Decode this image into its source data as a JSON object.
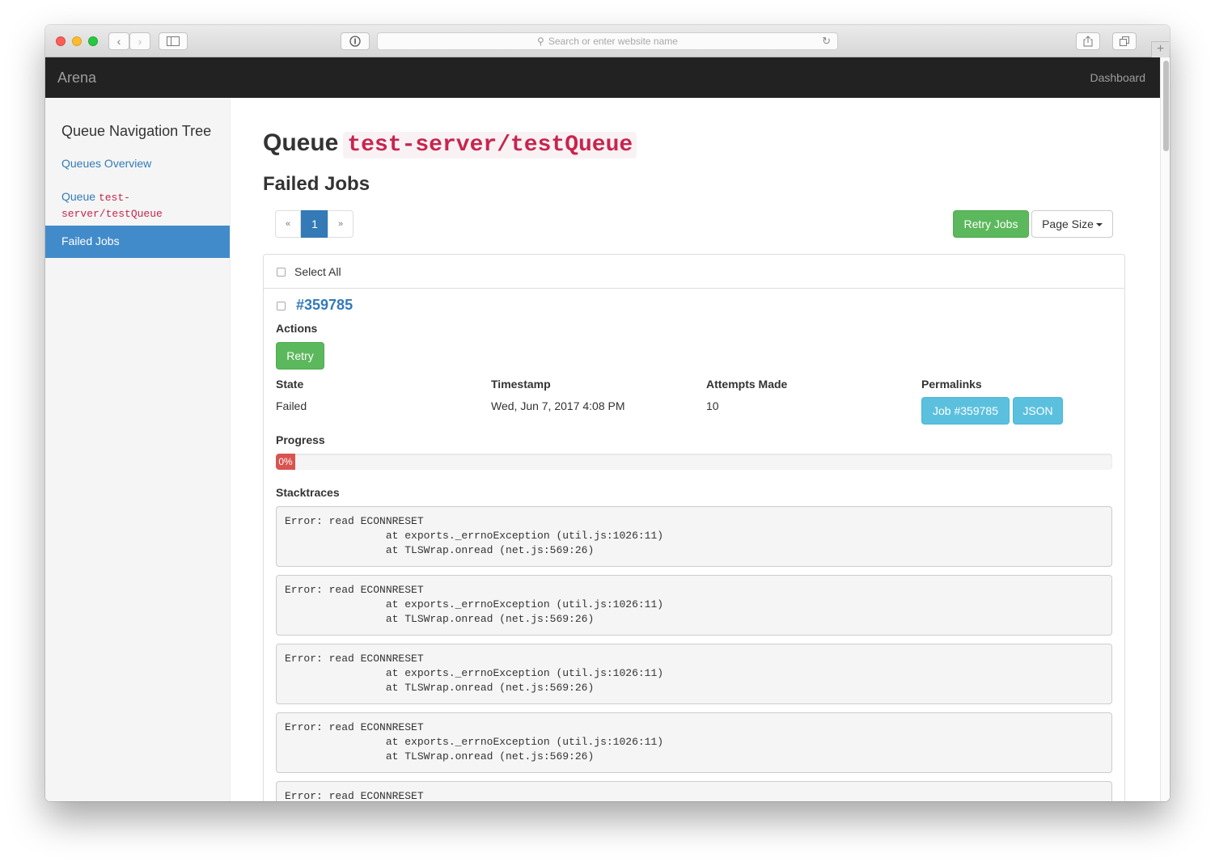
{
  "browser": {
    "address_placeholder": "Search or enter website name"
  },
  "navbar": {
    "brand": "Arena",
    "dashboard_link": "Dashboard"
  },
  "sidebar": {
    "title": "Queue Navigation Tree",
    "items": [
      {
        "label": "Queues Overview"
      },
      {
        "label": "Queue",
        "code": "test-server/testQueue"
      },
      {
        "label": "Failed Jobs",
        "active": true
      }
    ]
  },
  "main": {
    "heading_prefix": "Queue",
    "queue_name": "test-server/testQueue",
    "subheading": "Failed Jobs",
    "pagination": {
      "prev": "«",
      "current": "1",
      "next": "»"
    },
    "retry_jobs_label": "Retry Jobs",
    "page_size_label": "Page Size",
    "select_all_label": "Select All",
    "job": {
      "id_label": "#359785",
      "actions_label": "Actions",
      "retry_label": "Retry",
      "state_label": "State",
      "state_value": "Failed",
      "timestamp_label": "Timestamp",
      "timestamp_value": "Wed, Jun 7, 2017 4:08 PM",
      "attempts_label": "Attempts Made",
      "attempts_value": "10",
      "permalinks_label": "Permalinks",
      "permalink_job": "Job #359785",
      "permalink_json": "JSON",
      "progress_label": "Progress",
      "progress_value": 0,
      "progress_text": "0%",
      "stacktraces_label": "Stacktraces",
      "stacktraces": [
        "Error: read ECONNRESET\n                at exports._errnoException (util.js:1026:11)\n                at TLSWrap.onread (net.js:569:26)",
        "Error: read ECONNRESET\n                at exports._errnoException (util.js:1026:11)\n                at TLSWrap.onread (net.js:569:26)",
        "Error: read ECONNRESET\n                at exports._errnoException (util.js:1026:11)\n                at TLSWrap.onread (net.js:569:26)",
        "Error: read ECONNRESET\n                at exports._errnoException (util.js:1026:11)\n                at TLSWrap.onread (net.js:569:26)",
        "Error: read ECONNRESET"
      ]
    }
  },
  "colors": {
    "navbar_bg": "#222222",
    "link": "#337ab7",
    "success": "#5cb85c",
    "info": "#5bc0de",
    "danger": "#d9534f",
    "code": "#c7254e",
    "sidebar_active": "#428bca"
  }
}
